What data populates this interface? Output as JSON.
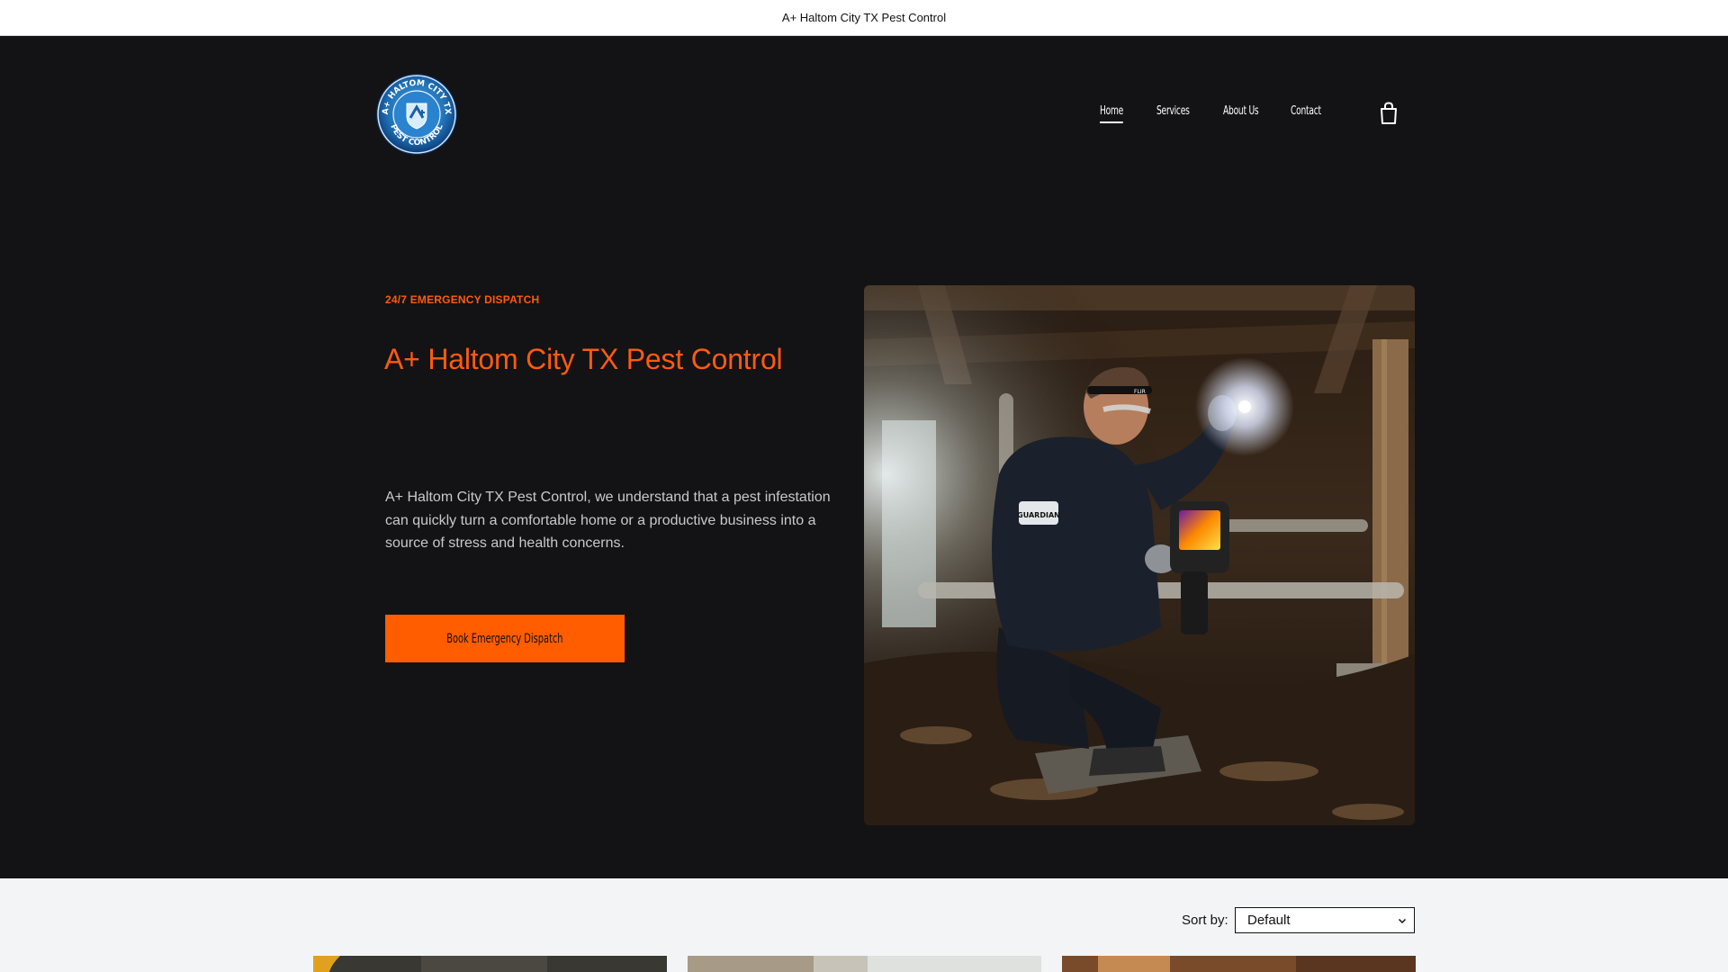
{
  "announcement": {
    "text": "A+ Haltom City TX Pest Control"
  },
  "brand": {
    "logo_icon": "pest-control-badge-logo",
    "logo_text_top": "A+ HALTOM CITY TX",
    "logo_text_bottom": "PEST CONTROL"
  },
  "nav": {
    "items": [
      {
        "label": "Home",
        "active": true
      },
      {
        "label": "Services",
        "active": false
      },
      {
        "label": "About Us",
        "active": false
      },
      {
        "label": "Contact",
        "active": false
      }
    ],
    "cart_icon": "shopping-bag-icon"
  },
  "hero": {
    "kicker": "24/7 EMERGENCY DISPATCH",
    "title": "A+ Haltom City TX Pest Control",
    "description": "A+ Haltom City TX Pest Control, we understand that a pest infestation can quickly turn a comfortable home or a productive business into a source of stress and health concerns.",
    "cta_label": "Book Emergency Dispatch",
    "image": {
      "badge_text": "GUARDIAN",
      "brand_text": "FLIR"
    }
  },
  "products": {
    "sort_label": "Sort by:",
    "sort_value": "Default"
  },
  "colors": {
    "accent": "#ff5b0f",
    "dark_bg": "#131215",
    "light_bg": "#f3f4f6"
  }
}
